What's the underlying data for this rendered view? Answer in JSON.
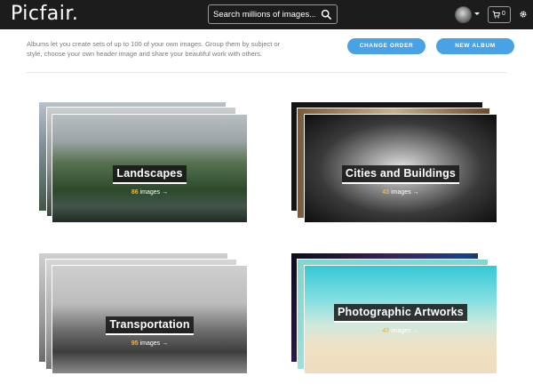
{
  "header": {
    "logo": "Picfair.",
    "search": {
      "placeholder": "Search millions of images..."
    },
    "cart_count": "0"
  },
  "intro": {
    "text": "Albums let you create sets of up to 100 of your own images. Group them by subject or style, choose your own header image and share your beautiful work with others."
  },
  "buttons": {
    "change_order": "CHANGE ORDER",
    "new_album": "NEW ALBUM"
  },
  "albums": [
    {
      "title": "Landscapes",
      "count": "86",
      "suffix": "images"
    },
    {
      "title": "Cities and Buildings",
      "count": "43",
      "suffix": "images"
    },
    {
      "title": "Transportation",
      "count": "95",
      "suffix": "images"
    },
    {
      "title": "Photographic Artworks",
      "count": "47",
      "suffix": "images"
    }
  ],
  "colors": {
    "topbar": "#1c1c1c",
    "accent_button": "#4aa2e6",
    "count_highlight": "#f4b63a"
  },
  "icons": [
    "search-icon",
    "avatar",
    "chevron-down-icon",
    "cart-icon",
    "gear-icon",
    "arrow-right-icon"
  ]
}
